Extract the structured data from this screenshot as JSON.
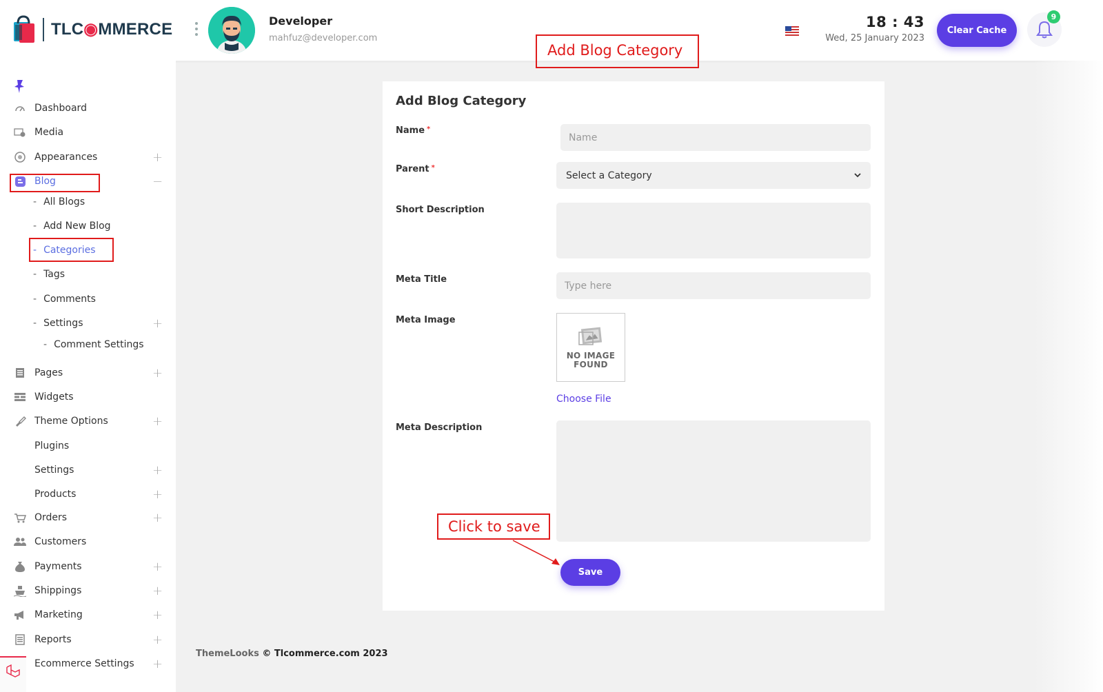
{
  "header": {
    "brand_prefix": "TLC",
    "brand_suffix": "MMERCE",
    "user_name": "Developer",
    "user_email": "mahfuz@developer.com",
    "time": "18 : 43",
    "date": "Wed, 25 January 2023",
    "clear_cache_label": "Clear Cache",
    "notification_count": "9"
  },
  "sidebar": {
    "items": [
      {
        "label": "Dashboard"
      },
      {
        "label": "Media"
      },
      {
        "label": "Appearances"
      },
      {
        "label": "Blog"
      },
      {
        "label": "Pages"
      },
      {
        "label": "Widgets"
      },
      {
        "label": "Theme Options"
      },
      {
        "label": "Plugins"
      },
      {
        "label": "Settings"
      },
      {
        "label": "Products"
      },
      {
        "label": "Orders"
      },
      {
        "label": "Customers"
      },
      {
        "label": "Payments"
      },
      {
        "label": "Shippings"
      },
      {
        "label": "Marketing"
      },
      {
        "label": "Reports"
      },
      {
        "label": "Ecommerce Settings"
      }
    ],
    "blog_children": [
      {
        "label": "All Blogs"
      },
      {
        "label": "Add New Blog"
      },
      {
        "label": "Categories"
      },
      {
        "label": "Tags"
      },
      {
        "label": "Comments"
      },
      {
        "label": "Settings"
      }
    ],
    "blog_settings_children": [
      {
        "label": "Comment Settings"
      }
    ]
  },
  "form": {
    "title": "Add Blog Category",
    "name_label": "Name",
    "name_placeholder": "Name",
    "required_mark": "*",
    "parent_label": "Parent",
    "parent_selected": "Select a Category",
    "short_desc_label": "Short Description",
    "meta_title_label": "Meta Title",
    "meta_title_placeholder": "Type here",
    "meta_image_label": "Meta Image",
    "no_image_line1": "NO IMAGE",
    "no_image_line2": "FOUND",
    "choose_file_label": "Choose File",
    "meta_desc_label": "Meta Description",
    "save_label": "Save"
  },
  "footer": {
    "brand": "ThemeLooks",
    "copyright": "© Tlcommerce.com 2023"
  },
  "annotations": {
    "top_label": "Add Blog Category",
    "save_label": "Click to save"
  },
  "colors": {
    "accent": "#5b3ee4",
    "annotation": "#e01b1b",
    "active_link": "#5b6ee1",
    "badge": "#2ecc71"
  }
}
